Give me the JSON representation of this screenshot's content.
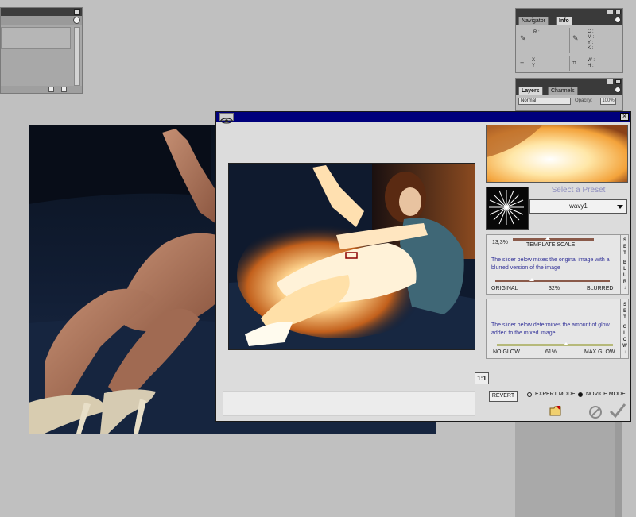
{
  "info_palette": {
    "tabs": [
      "Navigator",
      "Info"
    ],
    "active_tab": "Info",
    "rgb_label": "R :",
    "cmyk_label": "C :\nM :\nY :\nK :",
    "xy_label": "X :\nY :",
    "wh_label": "W :\nH :"
  },
  "layers_palette": {
    "tabs": [
      "Layers",
      "Channels"
    ],
    "active_tab": "Layers",
    "blend_mode": "Normal",
    "opacity_label": "Opacity:",
    "opacity_value": "100%"
  },
  "plugin": {
    "close_glyph": "×",
    "preset_label": "Select a Preset",
    "preset_value": "wavy1",
    "blur_panel": {
      "template_scale_value": "13,3%",
      "template_scale_label": "TEMPLATE SCALE",
      "description": "The slider below mixes the original image with a blurred version of the image",
      "left_label": "ORIGINAL",
      "value": "32%",
      "right_label": "BLURRED",
      "side_text": "SET BLUR",
      "blur_fraction": 0.32,
      "template_scale_fraction": 0.37
    },
    "glow_panel": {
      "description": "The slider below determines the amount of glow added to the mixed image",
      "left_label": "NO GLOW",
      "value": "61%",
      "right_label": "MAX GLOW",
      "side_text": "SET GLOW",
      "glow_fraction": 0.61
    },
    "one_to_one_label": "1:1",
    "revert_label": "REVERT",
    "expert_mode_label": "EXPERT MODE",
    "novice_mode_label": "NOVICE MODE",
    "selected_mode": "novice",
    "icons": [
      "eye-logo-icon",
      "folder-icon",
      "cancel-icon",
      "checkmark-icon",
      "menu-arrow-icon"
    ]
  }
}
